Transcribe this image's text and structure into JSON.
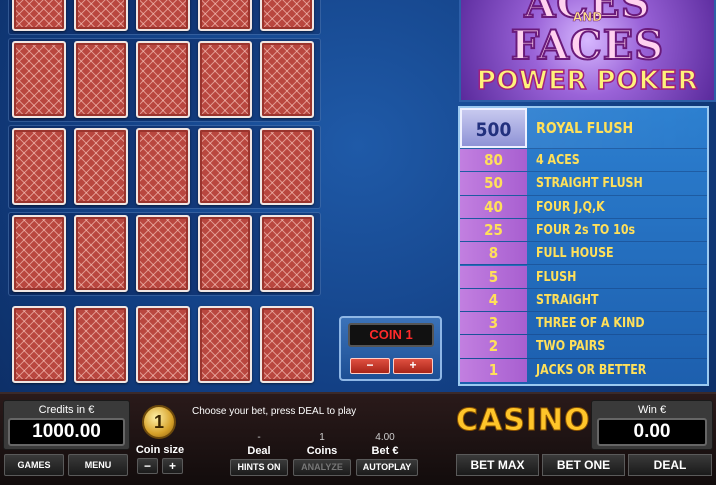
{
  "logo": {
    "line1": "ACES",
    "line2": "AND",
    "line3": "FACES",
    "line4": "POWER POKER"
  },
  "paytable": [
    {
      "value": "500",
      "hand": "ROYAL FLUSH"
    },
    {
      "value": "80",
      "hand": "4 ACES"
    },
    {
      "value": "50",
      "hand": "STRAIGHT FLUSH"
    },
    {
      "value": "40",
      "hand": "FOUR J,Q,K"
    },
    {
      "value": "25",
      "hand": "FOUR 2s TO 10s"
    },
    {
      "value": "8",
      "hand": "FULL HOUSE"
    },
    {
      "value": "5",
      "hand": "FLUSH"
    },
    {
      "value": "4",
      "hand": "STRAIGHT"
    },
    {
      "value": "3",
      "hand": "THREE OF A KIND"
    },
    {
      "value": "2",
      "hand": "TWO PAIRS"
    },
    {
      "value": "1",
      "hand": "JACKS OR BETTER"
    }
  ],
  "coin_selector": {
    "display": "COIN 1",
    "minus": "−",
    "plus": "+"
  },
  "credits": {
    "label": "Credits in €",
    "value": "1000.00"
  },
  "menu_buttons": {
    "games": "GAMES",
    "menu": "MENU"
  },
  "coin_size": {
    "value": "1",
    "label": "Coin size",
    "minus": "−",
    "plus": "+"
  },
  "message": "Choose your bet, press DEAL to play",
  "stats": {
    "deal_value": "-",
    "deal_label": "Deal",
    "coins_value": "1",
    "coins_label": "Coins",
    "bet_value": "4.00",
    "bet_label": "Bet €"
  },
  "controls": {
    "hints": "HINTS ON",
    "analyze": "ANALYZE",
    "autoplay": "AUTOPLAY"
  },
  "brand": "CASINO",
  "win": {
    "label": "Win €",
    "value": "0.00"
  },
  "action_buttons": {
    "bet_max": "BET MAX",
    "bet_one": "BET ONE",
    "deal": "DEAL"
  },
  "colors": {
    "card_back": "#b9473f",
    "paytable_bg": "#2c7fd0",
    "paytable_value_bg": "#a85fd0",
    "paytable_text": "#ffe05a",
    "coin_display_text": "#ff2a2a",
    "brand_gold": "#ffc52a"
  }
}
